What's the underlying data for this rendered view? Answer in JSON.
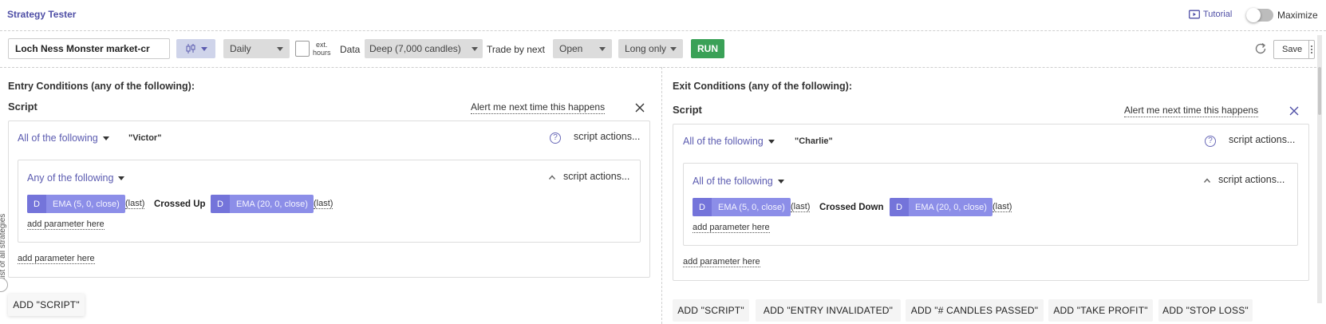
{
  "header": {
    "title": "Strategy Tester",
    "tutorial_label": "Tutorial",
    "maximize_label": "Maximize",
    "maximize_on": false
  },
  "toolbar": {
    "strategy_name": "Loch Ness Monster market-cr",
    "timeframe": "Daily",
    "ext_hours_label": "ext.\nhours",
    "ext_hours_checked": false,
    "data_label": "Data",
    "data_value": "Deep (7,000 candles)",
    "trade_by_next_label": "Trade by next",
    "trade_by_next_value": "Open",
    "direction_value": "Long only",
    "run_label": "RUN",
    "save_label": "Save"
  },
  "side_tab": {
    "label": "list of all strategies"
  },
  "entry": {
    "heading": "Entry Conditions (any of the following):",
    "script_label": "Script",
    "alert_label": "Alert me next time this happens",
    "outer_group": "All of the following",
    "script_name": "\"Victor\"",
    "script_actions": "script actions...",
    "inner_group": "Any of the following",
    "inner_actions": "script actions...",
    "condition": {
      "left_badge": "D",
      "left_value": "EMA (5, 0, close)",
      "left_last": "(last)",
      "operator": "Crossed Up",
      "right_badge": "D",
      "right_value": "EMA (20, 0, close)",
      "right_last": "(last)"
    },
    "inner_add_param": "add parameter here",
    "outer_add_param": "add parameter here",
    "add_buttons": [
      "ADD \"SCRIPT\""
    ]
  },
  "exit": {
    "heading": "Exit Conditions (any of the following):",
    "script_label": "Script",
    "alert_label": "Alert me next time this happens",
    "outer_group": "All of the following",
    "script_name": "\"Charlie\"",
    "script_actions": "script actions...",
    "inner_group": "All of the following",
    "inner_actions": "script actions...",
    "condition": {
      "left_badge": "D",
      "left_value": "EMA (5, 0, close)",
      "left_last": "(last)",
      "operator": "Crossed Down",
      "right_badge": "D",
      "right_value": "EMA (20, 0, close)",
      "right_last": "(last)"
    },
    "inner_add_param": "add parameter here",
    "outer_add_param": "add parameter here",
    "add_buttons": [
      "ADD \"SCRIPT\"",
      "ADD \"ENTRY INVALIDATED\"",
      "ADD \"# CANDLES PASSED\"",
      "ADD \"TAKE PROFIT\"",
      "ADD \"STOP LOSS\""
    ]
  },
  "colors": {
    "accent": "#4f4fa6",
    "run_green": "#3aa157",
    "pill": "#8c8ee8",
    "pill_badge": "#7474da"
  }
}
